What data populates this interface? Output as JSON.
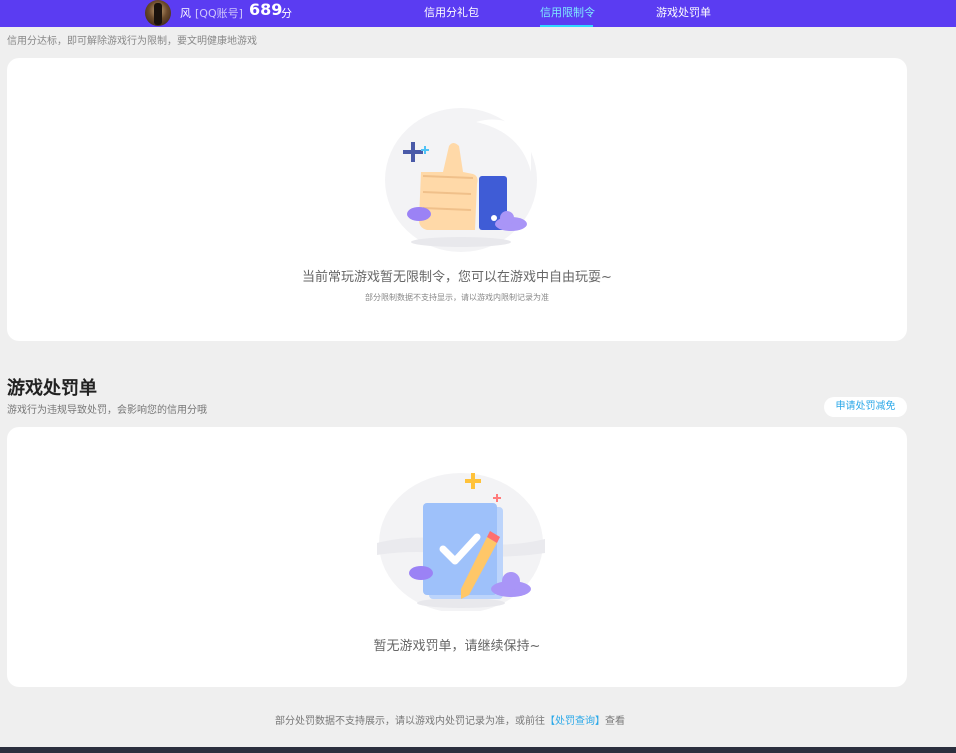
{
  "header": {
    "user_name": "风",
    "account_type": "[QQ账号]",
    "score": "689",
    "score_unit": "分",
    "nav": [
      {
        "label": "信用分礼包",
        "active": false
      },
      {
        "label": "信用限制令",
        "active": true
      },
      {
        "label": "游戏处罚单",
        "active": false
      }
    ]
  },
  "restriction": {
    "hint": "信用分达标，即可解除游戏行为限制，要文明健康地游戏",
    "empty_main": "当前常玩游戏暂无限制令，您可以在游戏中自由玩耍~",
    "empty_sub": "部分限制数据不支持显示，请以游戏内限制记录为准",
    "illustration_icon": "thumbs-up-icon"
  },
  "penalty": {
    "title": "游戏处罚单",
    "desc": "游戏行为违规导致处罚，会影响您的信用分哦",
    "apply_button": "申请处罚减免",
    "empty_main": "暂无游戏罚单，请继续保持~",
    "illustration_icon": "checked-clipboard-icon"
  },
  "footer": {
    "note_before": "部分处罚数据不支持展示，请以游戏内处罚记录为准，或前往",
    "link": "【处罚查询】",
    "note_after": "查看"
  },
  "colors": {
    "topbar": "#5b3cf2",
    "active_nav": "#7fe9ff",
    "link": "#2aa8e8"
  }
}
